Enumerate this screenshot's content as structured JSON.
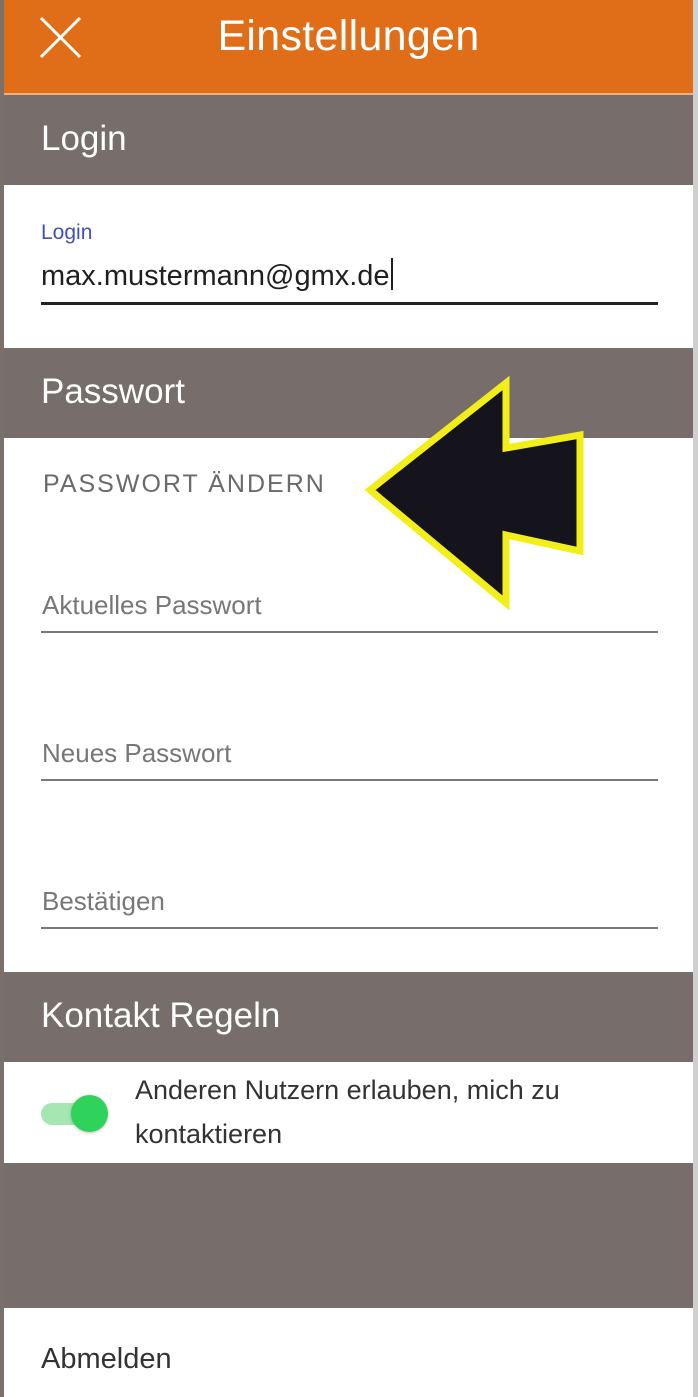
{
  "header": {
    "title": "Einstellungen",
    "close_icon": "close-icon"
  },
  "login_section": {
    "title": "Login",
    "field_label": "Login",
    "field_value": "max.mustermann@gmx.de"
  },
  "password_section": {
    "title": "Passwort",
    "subheading": "PASSWORT ÄNDERN",
    "current_placeholder": "Aktuelles Passwort",
    "new_placeholder": "Neues Passwort",
    "confirm_placeholder": "Bestätigen"
  },
  "contact_section": {
    "title": "Kontakt Regeln",
    "toggle_label": "Anderen Nutzern erlauben, mich zu kontaktieren",
    "toggle_on": true
  },
  "footer": {
    "logout_label": "Abmelden"
  },
  "colors": {
    "header_bg": "#e06d18",
    "section_bg": "#776d6a",
    "accent_label": "#3f51b5",
    "toggle_on": "#2fd25a",
    "annotation_arrow_fill": "#15141c",
    "annotation_arrow_outline": "#f2ee1a"
  },
  "annotation": {
    "icon": "arrow-left-icon"
  }
}
